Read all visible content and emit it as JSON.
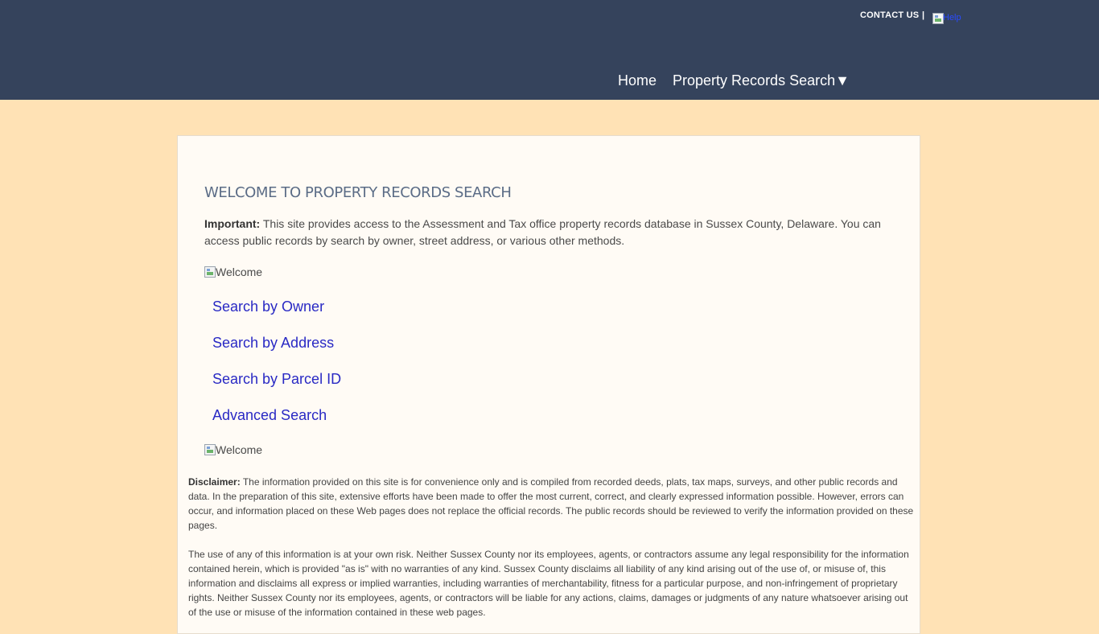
{
  "header": {
    "contact_label": "CONTACT US",
    "separator": "|",
    "help_alt": "Help",
    "nav": {
      "home": "Home",
      "property_records_search": "Property Records Search",
      "dropdown_arrow": "▼"
    },
    "colors": {
      "header_bg": "#35435c",
      "page_bg": "#ffe2b5"
    }
  },
  "main": {
    "title": "WELCOME TO PROPERTY RECORDS SEARCH",
    "intro_bold": "Important:",
    "intro_text": " This site provides access to the Assessment and Tax office property records database in Sussex County, Delaware. You can access public records by search by owner, street address, or various other methods.",
    "welcome_img_alt_top": "Welcome",
    "welcome_img_alt_bottom": "Welcome",
    "links": {
      "owner": "Search by Owner",
      "address": "Search by Address",
      "parcel": "Search by Parcel ID",
      "advanced": "Advanced Search"
    },
    "disclaimer_bold": "Disclaimer:",
    "disclaimer_text": " The information provided on this site is for convenience only and is compiled from recorded deeds, plats, tax maps, surveys, and other public records and data. In the preparation of this site, extensive efforts have been made to offer the most current, correct, and clearly expressed information possible. However, errors can occur, and information placed on these Web pages does not replace the official records. The public records should be reviewed to verify the information provided on these pages.",
    "disclaimer_text_2": "The use of any of this information is at your own risk. Neither Sussex County nor its employees, agents, or contractors assume any legal responsibility for the information contained herein, which is provided \"as is\" with no warranties of any kind. Sussex County disclaims all liability of any kind arising out of the use of, or misuse of, this information and disclaims all express or implied warranties, including warranties of merchantability, fitness for a particular purpose, and non-infringement of proprietary rights. Neither Sussex County nor its employees, agents, or contractors will be liable for any actions, claims, damages or judgments of any nature whatsoever arising out of the use or misuse of the information contained in these web pages."
  }
}
